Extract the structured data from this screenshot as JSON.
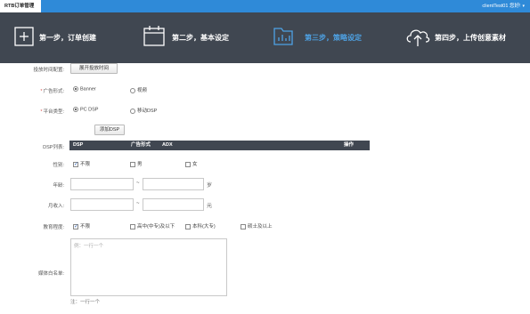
{
  "header": {
    "brand": "RTB订单管理",
    "user": "clientTest01 您好!"
  },
  "steps": [
    {
      "label": "第一步，订单创建",
      "icon": "plus-icon",
      "active": false
    },
    {
      "label": "第二步，基本设定",
      "icon": "calendar-icon",
      "active": false
    },
    {
      "label": "第三步，策略设定",
      "icon": "strategy-folder-icon",
      "active": true
    },
    {
      "label": "第四步，上传创意素材",
      "icon": "cloud-upload-icon",
      "active": false
    }
  ],
  "form": {
    "time_label": "投放时间配置:",
    "time_button": "展开投放时间",
    "ad_type_label": "广告形式:",
    "ad_type_options": [
      "Banner",
      "视频"
    ],
    "platform_label": "平台类型:",
    "platform_options": [
      "PC DSP",
      "移动DSP"
    ],
    "add_dsp_button": "添加DSP",
    "dsp_list_label": "DSP列表:",
    "dsp_columns": [
      "DSP",
      "广告形式",
      "ADX",
      "操作"
    ],
    "gender_label": "性别:",
    "gender_options": [
      "不限",
      "男",
      "女"
    ],
    "age_label": "年龄:",
    "age_sep": "~",
    "age_unit": "岁",
    "income_label": "月收入:",
    "income_sep": "~",
    "income_unit": "元",
    "education_label": "教育程度:",
    "education_options": [
      "不限",
      "高中(中专)及以下",
      "本科(大专)",
      "硕士及以上"
    ],
    "whitelist_label": "媒体白名单:",
    "whitelist_placeholder": "例：一行一个",
    "whitelist_note": "注：一行一个"
  }
}
